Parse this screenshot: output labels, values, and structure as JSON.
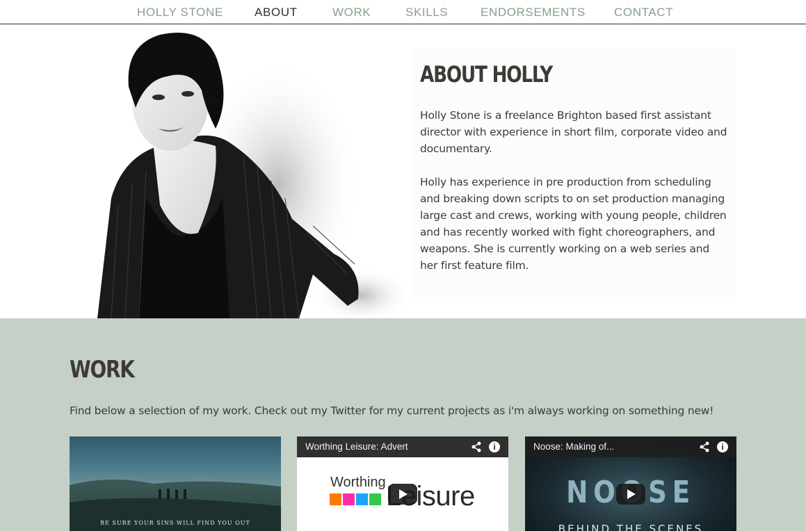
{
  "nav": {
    "items": [
      {
        "label": "HOLLY STONE",
        "active": false
      },
      {
        "label": "ABOUT",
        "active": true
      },
      {
        "label": "WORK",
        "active": false
      },
      {
        "label": "SKILLS",
        "active": false
      },
      {
        "label": "ENDORSEMENTS",
        "active": false
      },
      {
        "label": "CONTACT",
        "active": false
      }
    ]
  },
  "about": {
    "title": "ABOUT HOLLY",
    "paragraphs": [
      "Holly Stone is a freelance Brighton based first assistant director with experience in short film, corporate video and documentary.",
      "Holly has experience in pre production from scheduling and breaking down scripts to on set production managing large cast and crews, working with young people, children and has recently worked with fight choreographers, and weapons. She is currently working on a web series and her first feature film."
    ]
  },
  "work": {
    "title": "WORK",
    "intro": "Find below a selection of my work. Check out my Twitter for my current projects as i'm always working on something new!",
    "items": [
      {
        "type": "poster",
        "caption": "BE SURE YOUR SINS WILL FIND YOU OUT"
      },
      {
        "type": "video",
        "title": "Worthing Leisure: Advert",
        "logo_small": "Worthing",
        "logo_big": "Leisure"
      },
      {
        "type": "video",
        "title": "Noose: Making of...",
        "headline": "NOOSE",
        "subline": "BEHIND THE SCENES"
      }
    ]
  },
  "colors": {
    "nav_text": "#8a9e8a",
    "nav_active": "#2f2f2f",
    "work_background": "#c5d0c7",
    "heading": "#3d3a36"
  },
  "icons": [
    "share-icon",
    "info-icon",
    "play-icon"
  ]
}
